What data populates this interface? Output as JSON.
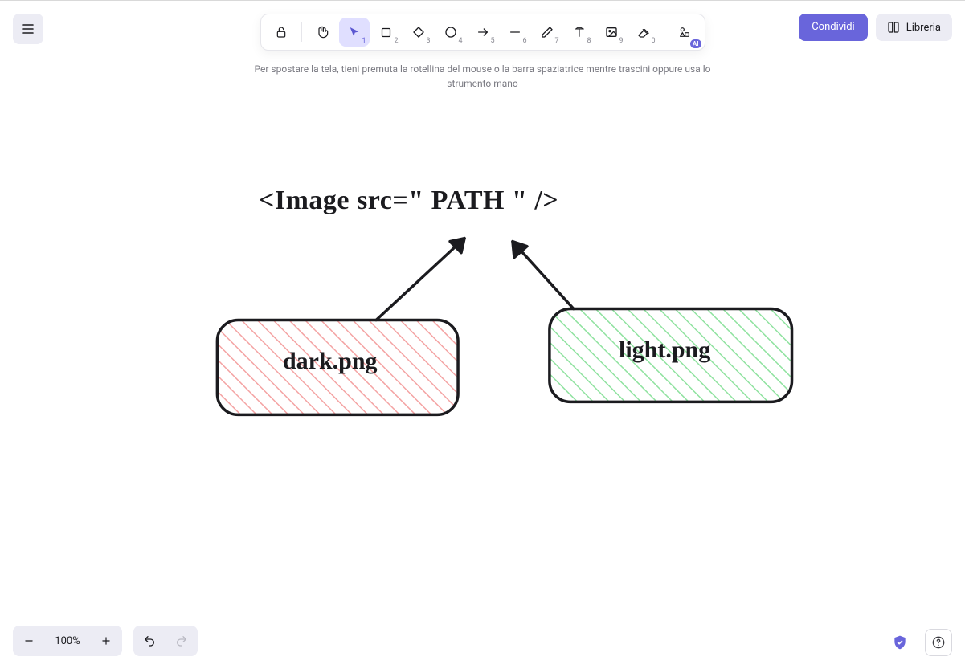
{
  "colors": {
    "accent": "#6965db",
    "toolActiveBg": "#e0dfff"
  },
  "menu": {
    "label": "Menu"
  },
  "toolbar": {
    "tools": [
      {
        "id": "lock",
        "key": "",
        "active": false
      },
      {
        "id": "hand",
        "key": "",
        "active": false
      },
      {
        "id": "select",
        "key": "1",
        "active": true
      },
      {
        "id": "rectangle",
        "key": "2",
        "active": false
      },
      {
        "id": "diamond",
        "key": "3",
        "active": false
      },
      {
        "id": "ellipse",
        "key": "4",
        "active": false
      },
      {
        "id": "arrow",
        "key": "5",
        "active": false
      },
      {
        "id": "line",
        "key": "6",
        "active": false
      },
      {
        "id": "draw",
        "key": "7",
        "active": false
      },
      {
        "id": "text",
        "key": "8",
        "active": false
      },
      {
        "id": "image",
        "key": "9",
        "active": false
      },
      {
        "id": "eraser",
        "key": "0",
        "active": false
      },
      {
        "id": "more",
        "key": "",
        "active": false,
        "ai_badge": "AI"
      }
    ]
  },
  "top_right": {
    "share_label": "Condividi",
    "library_label": "Libreria"
  },
  "hint": {
    "text": "Per spostare la tela, tieni premuta la rotellina del mouse o la barra spaziatrice mentre trascini oppure usa lo strumento mano"
  },
  "diagram": {
    "header_text": "<Image src=\" PATH \" />",
    "boxes": [
      {
        "id": "dark",
        "label": "dark.png",
        "fill_stroke": "#f4a3a3"
      },
      {
        "id": "light",
        "label": "light.png",
        "fill_stroke": "#8fe29f"
      }
    ]
  },
  "zoom": {
    "out_label": "−",
    "in_label": "+",
    "level": "100%"
  },
  "history": {
    "undo": "↶",
    "redo": "↷"
  },
  "bottom_right": {
    "help": "?"
  }
}
